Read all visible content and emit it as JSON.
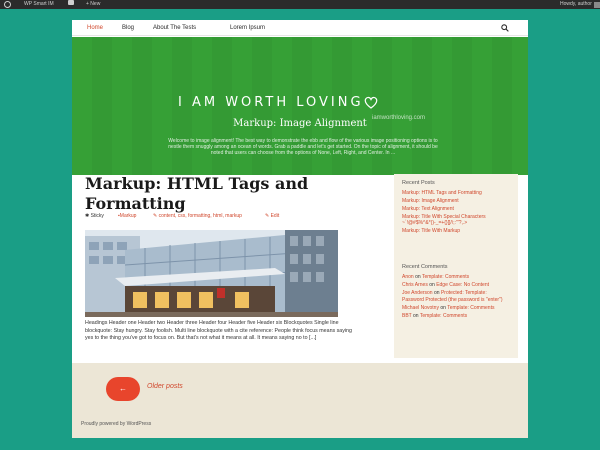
{
  "admin_bar": {
    "site_name": "WP Smart IM",
    "new_label": "+ New",
    "greeting": "Howdy, author"
  },
  "nav": {
    "items": [
      {
        "label": "Home"
      },
      {
        "label": "Blog"
      },
      {
        "label": "About The Tests"
      },
      {
        "label": "Lorem Ipsum"
      }
    ]
  },
  "header": {
    "site_title": "I AM WORTH LOVING",
    "site_url": "iamworthloving.com",
    "page_title": "Markup: Image Alignment",
    "description": "Welcome to image alignment! The best way to demonstrate the ebb and flow of the various image positioning options is to nestle them snuggly among an ocean of words. Grab a paddle and let's get started. On the topic of alignment, it should be noted that users can choose from the options of None, Left, Right, and Center. In ..."
  },
  "post": {
    "title": "Markup: HTML Tags and Formatting",
    "meta": {
      "sticky": "Sticky",
      "category": "Markup",
      "tags": "content, css, formatting, html, markup",
      "edit": "Edit"
    },
    "excerpt": "Headings Header one Header two Header three Header four Header five Header six Blockquotes Single line blockquote: Stay hungry. Stay foolish. Multi line blockquote with a cite reference: People think focus means saying yes to the thing you've got to focus on. But that's not what it means at all. It means saying no to [...]"
  },
  "sidebar": {
    "recent_posts": {
      "title": "Recent Posts",
      "items": [
        "Markup: HTML Tags and Formatting",
        "Markup: Image Alignment",
        "Markup: Text Alignment",
        "Markup: Title With Special Characters ~`!@#$%^&*()-_=+{}[]/\\;:'\"?,.>",
        "Markup: Title With Markup"
      ]
    },
    "recent_comments": {
      "title": "Recent Comments",
      "items": [
        {
          "author": "Anon",
          "sep": " on ",
          "post": "Template: Comments"
        },
        {
          "author": "Chris Arnes",
          "sep": " on ",
          "post": "Edge Case: No Content"
        },
        {
          "author": "Joe Anderson",
          "sep": " on ",
          "post": "Protected: Template: Password Protected (the password is \"enter\")"
        },
        {
          "author": "Michael Novotny",
          "sep": " on ",
          "post": "Template: Comments"
        },
        {
          "author": "BBT",
          "sep": " on ",
          "post": "Template: Comments"
        }
      ]
    }
  },
  "pagination": {
    "arrow": "←",
    "older_label": "Older posts"
  },
  "footer": {
    "credits": "Proudly powered by WordPress"
  },
  "colors": {
    "page_bg": "#1a9e86",
    "header_green": "#36a036",
    "accent_red": "#d0472c",
    "widget_bg": "#f5f0e3"
  }
}
